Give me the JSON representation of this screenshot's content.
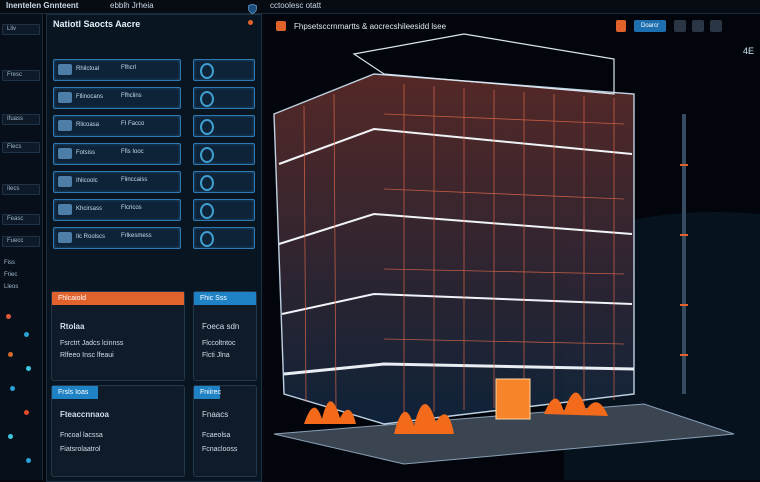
{
  "topbar": {
    "app_title": "Inentelen Gnnteent",
    "menu_item": "ebblh Jrheia",
    "center_label": "cctoolesc otatt",
    "logo_icon": "shield-logo-icon"
  },
  "rail": {
    "items": [
      "Lliv",
      "Fresc",
      "Ifuass",
      "Flecs",
      "Ilecs",
      "Feasc",
      "Fuecc",
      "Friec",
      "Lleos"
    ],
    "section_label": "Fiss",
    "status_colors": [
      "#e2593a",
      "#d36a2a",
      "#2aa3d6",
      "#3ec7e0",
      "#e44b2b"
    ]
  },
  "panel": {
    "title": "Natiotl Saocts Aacre",
    "grid": [
      {
        "col1": "Rhilctoal",
        "col2": "Ffhcrl"
      },
      {
        "col1": "Fllinocans",
        "col2": "Ffhclins"
      },
      {
        "col1": "Rlicoasa",
        "col2": "FI Facco"
      },
      {
        "col1": "Fotsiss",
        "col2": "Ffis Iooc"
      },
      {
        "col1": "Ihlicoolc",
        "col2": "Flinccaiss"
      },
      {
        "col1": "Khcirsass",
        "col2": "Flcricos"
      },
      {
        "col1": "Ilc Roolscs",
        "col2": "Frlkesmess"
      }
    ],
    "cards": [
      {
        "header": "Fhlcaiold",
        "title": "Rtolaa",
        "lines": [
          "Fsrctrt Jadcs lcinnss",
          "Rlfeeo Insc lfeaui"
        ]
      },
      {
        "header": "Fhic Sss",
        "title": "Foeca sdn",
        "lines": [
          "Flccoltntoc",
          "Flcti Jlna"
        ]
      },
      {
        "header": "Frsls Ioas",
        "title": "Fteaccnnaoa",
        "lines": [
          "Fncoal lacssa",
          "Fiatsrolaatrol"
        ]
      },
      {
        "header": "Fniirec",
        "title": "Fnaacs",
        "lines": [
          "Fcaeolsa",
          "Fcnaclooss"
        ]
      }
    ]
  },
  "viewer": {
    "title": "Fhpsetsccrnmartts & aocrecshileesidd lsee",
    "button_label": "Doarcr",
    "corner_label": "4E",
    "accent": "#e2622c",
    "flame": "#f26a1a"
  }
}
